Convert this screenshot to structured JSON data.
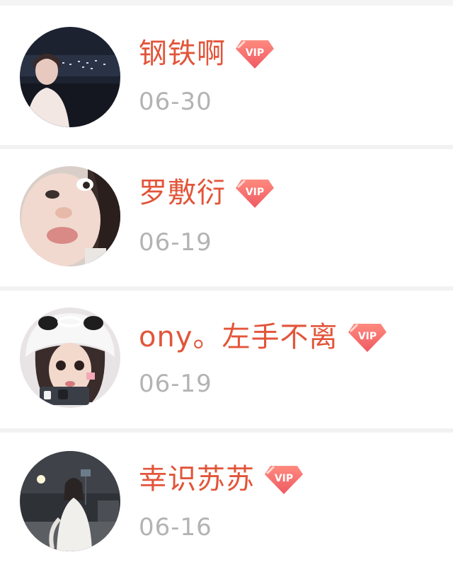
{
  "comments": [
    {
      "name": "钢铁啊",
      "badge": "VIP",
      "date": "06-30",
      "avatar_icon": "user-avatar-night-city"
    },
    {
      "name": "罗敷衍",
      "badge": "VIP",
      "date": "06-19",
      "avatar_icon": "user-avatar-face-closeup"
    },
    {
      "name": "ony。左手不离",
      "badge": "VIP",
      "date": "06-19",
      "avatar_icon": "user-avatar-panda-hat-selfie"
    },
    {
      "name": "幸识苏苏",
      "badge": "VIP",
      "date": "06-16",
      "avatar_icon": "user-avatar-night-street"
    }
  ],
  "colors": {
    "name": "#e2553a",
    "date": "#b3b3b3",
    "vip_badge": "#f06a6e",
    "divider": "#f2f2f2"
  }
}
